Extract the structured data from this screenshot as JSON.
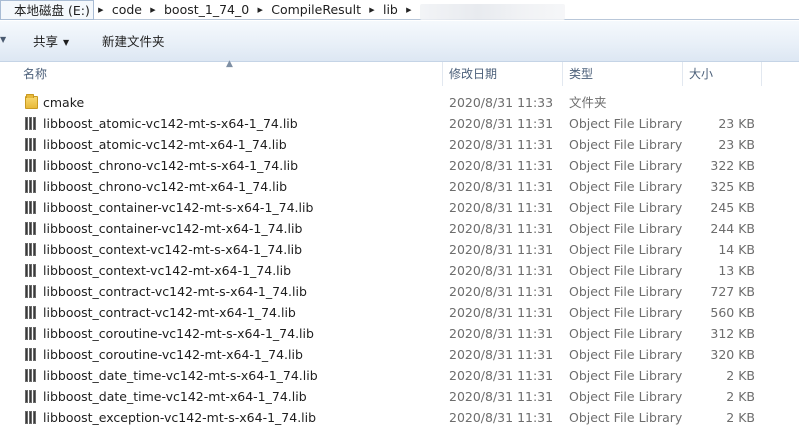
{
  "address": {
    "crumbs": [
      "本地磁盘 (E:)",
      "code",
      "boost_1_74_0",
      "CompileResult",
      "lib"
    ]
  },
  "toolbar": {
    "share_label": "共享",
    "new_folder_label": "新建文件夹"
  },
  "columns": {
    "name": "名称",
    "date": "修改日期",
    "type": "类型",
    "size": "大小"
  },
  "files": [
    {
      "name": "cmake",
      "date": "2020/8/31 11:33",
      "type": "文件夹",
      "size": "",
      "icon": "folder-icon"
    },
    {
      "name": "libboost_atomic-vc142-mt-s-x64-1_74.lib",
      "date": "2020/8/31 11:31",
      "type": "Object File Library",
      "size": "23 KB",
      "icon": "lib-file-icon"
    },
    {
      "name": "libboost_atomic-vc142-mt-x64-1_74.lib",
      "date": "2020/8/31 11:31",
      "type": "Object File Library",
      "size": "23 KB",
      "icon": "lib-file-icon"
    },
    {
      "name": "libboost_chrono-vc142-mt-s-x64-1_74.lib",
      "date": "2020/8/31 11:31",
      "type": "Object File Library",
      "size": "322 KB",
      "icon": "lib-file-icon"
    },
    {
      "name": "libboost_chrono-vc142-mt-x64-1_74.lib",
      "date": "2020/8/31 11:31",
      "type": "Object File Library",
      "size": "325 KB",
      "icon": "lib-file-icon"
    },
    {
      "name": "libboost_container-vc142-mt-s-x64-1_74.lib",
      "date": "2020/8/31 11:31",
      "type": "Object File Library",
      "size": "245 KB",
      "icon": "lib-file-icon"
    },
    {
      "name": "libboost_container-vc142-mt-x64-1_74.lib",
      "date": "2020/8/31 11:31",
      "type": "Object File Library",
      "size": "244 KB",
      "icon": "lib-file-icon"
    },
    {
      "name": "libboost_context-vc142-mt-s-x64-1_74.lib",
      "date": "2020/8/31 11:31",
      "type": "Object File Library",
      "size": "14 KB",
      "icon": "lib-file-icon"
    },
    {
      "name": "libboost_context-vc142-mt-x64-1_74.lib",
      "date": "2020/8/31 11:31",
      "type": "Object File Library",
      "size": "13 KB",
      "icon": "lib-file-icon"
    },
    {
      "name": "libboost_contract-vc142-mt-s-x64-1_74.lib",
      "date": "2020/8/31 11:31",
      "type": "Object File Library",
      "size": "727 KB",
      "icon": "lib-file-icon"
    },
    {
      "name": "libboost_contract-vc142-mt-x64-1_74.lib",
      "date": "2020/8/31 11:31",
      "type": "Object File Library",
      "size": "560 KB",
      "icon": "lib-file-icon"
    },
    {
      "name": "libboost_coroutine-vc142-mt-s-x64-1_74.lib",
      "date": "2020/8/31 11:31",
      "type": "Object File Library",
      "size": "312 KB",
      "icon": "lib-file-icon"
    },
    {
      "name": "libboost_coroutine-vc142-mt-x64-1_74.lib",
      "date": "2020/8/31 11:31",
      "type": "Object File Library",
      "size": "320 KB",
      "icon": "lib-file-icon"
    },
    {
      "name": "libboost_date_time-vc142-mt-s-x64-1_74.lib",
      "date": "2020/8/31 11:31",
      "type": "Object File Library",
      "size": "2 KB",
      "icon": "lib-file-icon"
    },
    {
      "name": "libboost_date_time-vc142-mt-x64-1_74.lib",
      "date": "2020/8/31 11:31",
      "type": "Object File Library",
      "size": "2 KB",
      "icon": "lib-file-icon"
    },
    {
      "name": "libboost_exception-vc142-mt-s-x64-1_74.lib",
      "date": "2020/8/31 11:31",
      "type": "Object File Library",
      "size": "2 KB",
      "icon": "lib-file-icon"
    }
  ]
}
